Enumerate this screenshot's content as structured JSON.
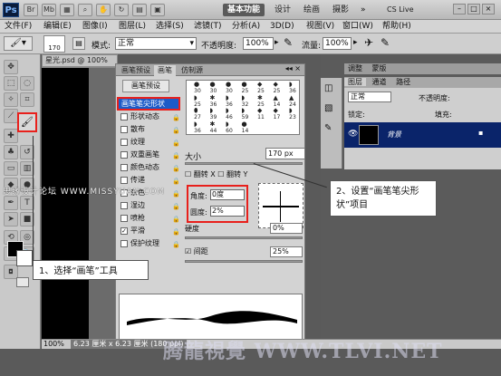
{
  "app": {
    "logo": "Ps",
    "workspace_buttons": [
      "基本功能",
      "设计",
      "绘画",
      "摄影"
    ],
    "cslive": "CS Live"
  },
  "menu": [
    "文件(F)",
    "编辑(E)",
    "图像(I)",
    "图层(L)",
    "选择(S)",
    "滤镜(T)",
    "分析(A)",
    "3D(D)",
    "视图(V)",
    "窗口(W)",
    "帮助(H)"
  ],
  "options": {
    "size": "170",
    "mode_label": "模式:",
    "mode_value": "正常",
    "opacity_label": "不透明度:",
    "opacity_value": "100%",
    "flow_label": "流量:",
    "flow_value": "100%"
  },
  "doc_tab": "星光.psd @ 100%(图...",
  "brush_panel": {
    "tabs": [
      "画笔预设",
      "画笔",
      "仿制源"
    ],
    "preset_button": "画笔预设",
    "items": [
      "画笔笔尖形状",
      "形状动态",
      "散布",
      "纹理",
      "双重画笔",
      "颜色动态",
      "传递",
      "杂色",
      "湿边",
      "喷枪",
      "平滑",
      "保护纹理"
    ],
    "tip_sizes": [
      "30",
      "30",
      "30",
      "25",
      "25",
      "25",
      "36",
      "25",
      "36",
      "36",
      "32",
      "25",
      "14",
      "24",
      "27",
      "39",
      "46",
      "59",
      "11",
      "17",
      "23",
      "36",
      "44",
      "60",
      "14"
    ],
    "size_label": "大小",
    "size_value": "170 px",
    "flip_x": "翻转 X",
    "flip_y": "翻转 Y",
    "angle_label": "角度:",
    "angle_value": "0度",
    "roundness_label": "圆度:",
    "roundness_value": "2%",
    "hardness_label": "硬度",
    "hardness_value": "0%",
    "spacing_label": "间距",
    "spacing_value": "25%"
  },
  "right_panel": {
    "adj_tabs": [
      "调整",
      "蒙版"
    ],
    "layer_tabs": [
      "图层",
      "通道",
      "路径"
    ],
    "blend": "正常",
    "opacity_label": "不透明度:",
    "lock_label": "锁定:",
    "fill_label": "填充:",
    "layer_name": "背景"
  },
  "status": {
    "zoom": "100%",
    "doc": "6.23 厘米 x 6.23 厘米 (180 ppi)"
  },
  "callouts": {
    "step1": "1、选择“画笔”工具",
    "step2": "2、设置“画笔笔尖形状”项目"
  },
  "watermarks": {
    "left": "思缘设计论坛  WWW.MISSYUAN.COM",
    "bottom": "腾龍視覺 WWW.TLVI.NET"
  }
}
